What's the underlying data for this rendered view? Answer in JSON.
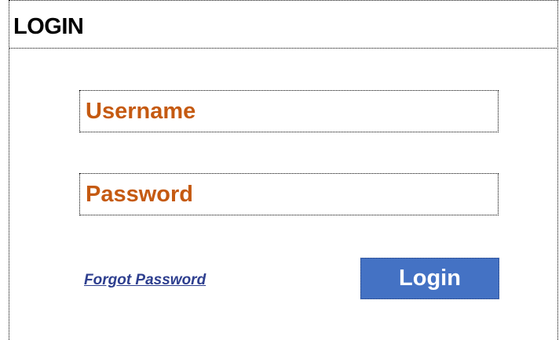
{
  "header": {
    "title": "LOGIN"
  },
  "form": {
    "username_label": "Username",
    "password_label": "Password",
    "forgot_password_label": "Forgot Password",
    "login_button_label": "Login"
  },
  "colors": {
    "field_label": "#c55a11",
    "link": "#2e3f8f",
    "button_background": "#4472c4",
    "button_text": "#ffffff"
  }
}
